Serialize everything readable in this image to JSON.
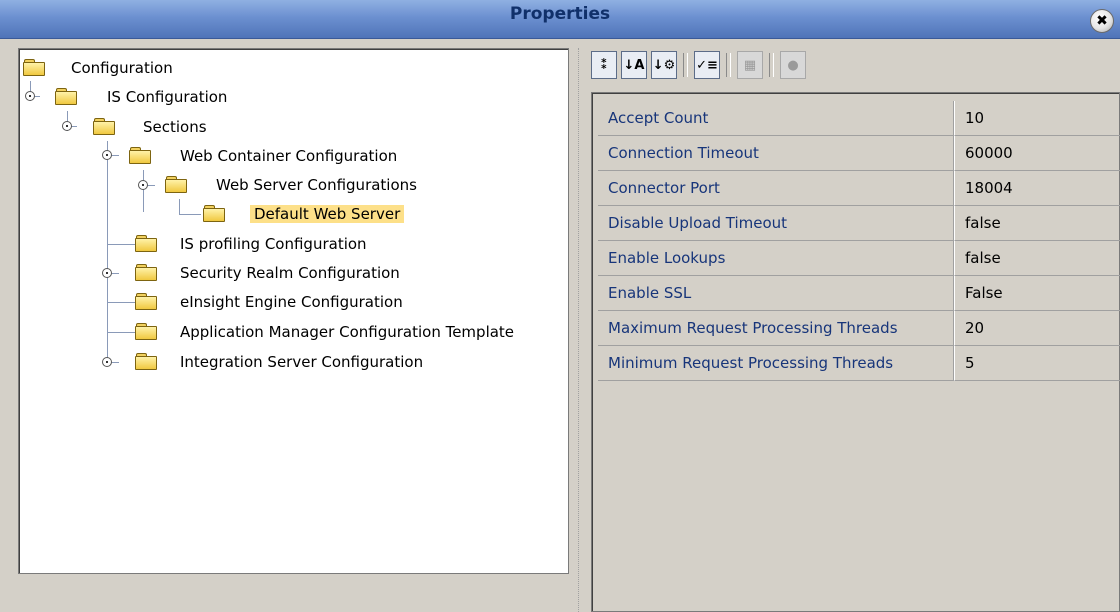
{
  "window": {
    "title": "Properties",
    "close_label": "✖"
  },
  "tree": {
    "root": "Configuration",
    "is_config": "IS Configuration",
    "sections": "Sections",
    "web_container": "Web Container Configuration",
    "web_server_configs": "Web Server Configurations",
    "default_web_server": "Default Web Server",
    "is_profiling": "IS profiling Configuration",
    "security_realm": "Security Realm Configuration",
    "einsight_engine": "eInsight Engine Configuration",
    "app_manager": "Application Manager Configuration Template",
    "integration_server": "Integration Server Configuration",
    "selected": "Default Web Server"
  },
  "toolbar": {
    "buttons": [
      {
        "icon": "unsorted-icon",
        "glyph": "⁑"
      },
      {
        "icon": "sort-by-name-icon",
        "glyph": "↓A"
      },
      {
        "icon": "sort-by-type-icon",
        "glyph": "↓⚙"
      },
      {
        "icon": "show-editable-icon",
        "glyph": "✓≡"
      },
      {
        "icon": "customize-icon",
        "glyph": "▦"
      },
      {
        "icon": "help-icon",
        "glyph": "●"
      }
    ]
  },
  "properties": {
    "rows": [
      {
        "name": "Accept Count",
        "value": "10"
      },
      {
        "name": "Connection Timeout",
        "value": "60000"
      },
      {
        "name": "Connector Port",
        "value": "18004"
      },
      {
        "name": "Disable Upload Timeout",
        "value": "false"
      },
      {
        "name": "Enable Lookups",
        "value": "false"
      },
      {
        "name": "Enable SSL",
        "value": "False"
      },
      {
        "name": "Maximum Request Processing Threads",
        "value": "20"
      },
      {
        "name": "Minimum Request Processing Threads",
        "value": "5"
      }
    ]
  },
  "colors": {
    "title_gradient_top": "#8fb0e2",
    "title_gradient_bottom": "#4f74b8",
    "selection_highlight": "#fde089",
    "property_name_text": "#17357a"
  }
}
